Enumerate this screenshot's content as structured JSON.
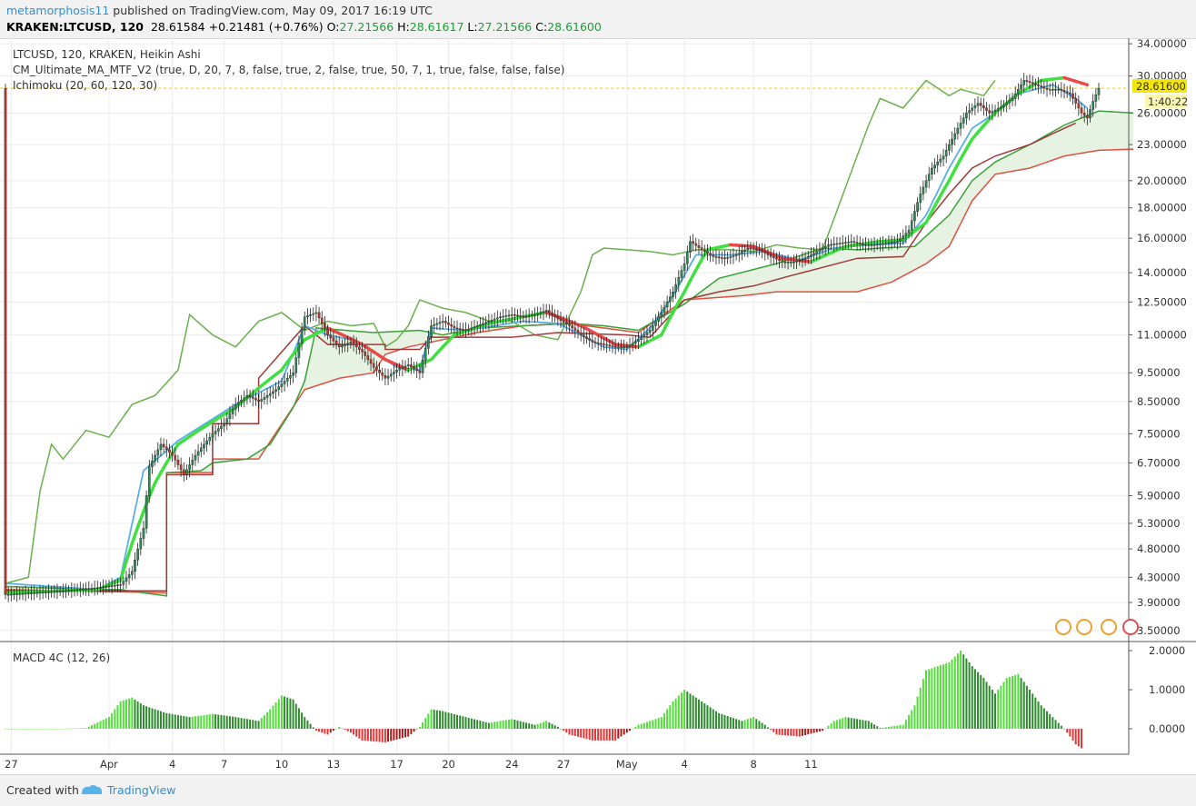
{
  "header": {
    "author": "metamorphosis11",
    "published_text": "published on TradingView.com, May 09, 2017 16:19 UTC",
    "symbol_line": "KRAKEN:LTCUSD, 120",
    "last": "28.61584",
    "change": "+0.21481 (+0.76%)",
    "open_label": "O:",
    "open": "27.21566",
    "high_label": "H:",
    "high": "28.61617",
    "low_label": "L:",
    "low": "27.21566",
    "close_label": "C:",
    "close": "28.61600"
  },
  "legend": {
    "main": "LTCUSD, 120, KRAKEN, Heikin Ashi",
    "indicator1": "CM_Ultimate_MA_MTF_V2 (true, D, 20, 7, 8, false, true, 2, false, true, 50, 7, 1, true, false, false, false)",
    "indicator2": "Ichimoku (20, 60, 120, 30)",
    "macd": "MACD 4C (12, 26)"
  },
  "price_tag": {
    "value": "28.61600",
    "countdown": "1:40:22"
  },
  "footer": {
    "created": "Created with",
    "brand": "TradingView"
  },
  "colors": {
    "up": "#2e8b57",
    "down": "#c0392b",
    "ma_up": "#40e040",
    "ma_down": "#e84a4a",
    "conversion": "#5aaee8",
    "base": "#9e3a3a",
    "lagging": "#6ab04c",
    "span_a": "#3aa03a",
    "span_b": "#e05040",
    "cloud": "#e6f2e2",
    "macd_up": "#55dd3c",
    "macd_up2": "#2e8b2e",
    "macd_down": "#e03a3a",
    "macd_down2": "#a31e1e"
  },
  "chart_data": {
    "type": "candlestick",
    "price_axis_ticks": [
      "34.00000",
      "30.00000",
      "26.00000",
      "23.00000",
      "20.00000",
      "18.00000",
      "16.00000",
      "14.00000",
      "12.50000",
      "11.00000",
      "9.50000",
      "8.50000",
      "7.50000",
      "6.70000",
      "5.90000",
      "5.30000",
      "4.80000",
      "4.30000",
      "3.90000",
      "3.50000"
    ],
    "date_ticks": [
      "27",
      "Apr",
      "4",
      "7",
      "10",
      "13",
      "17",
      "20",
      "24",
      "27",
      "May",
      "4",
      "8",
      "11"
    ],
    "macd_axis_ticks": [
      "2.0000",
      "1.0000",
      "0.0000"
    ],
    "ylim": [
      3.4,
      34.5
    ],
    "scale": "log",
    "price_path": [
      [
        0,
        4.02
      ],
      [
        5,
        4.05
      ],
      [
        10,
        4.08
      ],
      [
        15,
        4.12
      ],
      [
        20,
        4.18
      ],
      [
        22,
        4.4
      ],
      [
        24,
        5.2
      ],
      [
        25,
        6.6
      ],
      [
        27,
        7.2
      ],
      [
        29,
        6.9
      ],
      [
        31,
        6.4
      ],
      [
        33,
        6.9
      ],
      [
        36,
        7.5
      ],
      [
        38,
        7.8
      ],
      [
        40,
        8.4
      ],
      [
        42,
        8.7
      ],
      [
        44,
        8.5
      ],
      [
        47,
        8.9
      ],
      [
        50,
        9.5
      ],
      [
        52,
        11.8
      ],
      [
        54,
        12.0
      ],
      [
        56,
        11.0
      ],
      [
        58,
        10.5
      ],
      [
        60,
        10.7
      ],
      [
        62,
        10.3
      ],
      [
        64,
        9.7
      ],
      [
        66,
        9.3
      ],
      [
        68,
        9.6
      ],
      [
        70,
        9.8
      ],
      [
        72,
        9.5
      ],
      [
        74,
        11.4
      ],
      [
        76,
        11.6
      ],
      [
        78,
        11.3
      ],
      [
        80,
        11.2
      ],
      [
        82,
        11.4
      ],
      [
        84,
        11.6
      ],
      [
        86,
        11.8
      ],
      [
        88,
        11.9
      ],
      [
        90,
        11.8
      ],
      [
        92,
        11.9
      ],
      [
        94,
        12.1
      ],
      [
        96,
        11.7
      ],
      [
        98,
        11.4
      ],
      [
        100,
        11.0
      ],
      [
        102,
        10.7
      ],
      [
        104,
        10.6
      ],
      [
        106,
        10.5
      ],
      [
        108,
        10.5
      ],
      [
        110,
        10.8
      ],
      [
        112,
        11.2
      ],
      [
        114,
        12.0
      ],
      [
        116,
        13.0
      ],
      [
        118,
        14.5
      ],
      [
        119,
        15.8
      ],
      [
        121,
        15.3
      ],
      [
        123,
        14.9
      ],
      [
        125,
        14.8
      ],
      [
        127,
        15.0
      ],
      [
        129,
        15.4
      ],
      [
        131,
        15.3
      ],
      [
        133,
        14.9
      ],
      [
        135,
        14.6
      ],
      [
        137,
        14.6
      ],
      [
        139,
        14.8
      ],
      [
        141,
        15.2
      ],
      [
        143,
        15.6
      ],
      [
        145,
        15.7
      ],
      [
        147,
        15.8
      ],
      [
        149,
        15.6
      ],
      [
        151,
        15.6
      ],
      [
        153,
        15.7
      ],
      [
        155,
        15.8
      ],
      [
        157,
        16.5
      ],
      [
        159,
        19.0
      ],
      [
        161,
        21.0
      ],
      [
        163,
        22.0
      ],
      [
        165,
        24.0
      ],
      [
        167,
        26.0
      ],
      [
        169,
        27.0
      ],
      [
        171,
        26.0
      ],
      [
        173,
        26.6
      ],
      [
        175,
        27.5
      ],
      [
        177,
        29.5
      ],
      [
        179,
        29.0
      ],
      [
        181,
        28.5
      ],
      [
        183,
        28.5
      ],
      [
        185,
        28.0
      ],
      [
        187,
        26.0
      ],
      [
        188,
        25.5
      ],
      [
        189,
        27.2
      ],
      [
        190,
        28.6
      ]
    ],
    "ma_path": [
      [
        0,
        4.05
      ],
      [
        16,
        4.1
      ],
      [
        20,
        4.25
      ],
      [
        26,
        6.2
      ],
      [
        30,
        7.2
      ],
      [
        40,
        8.3
      ],
      [
        48,
        9.6
      ],
      [
        52,
        10.8
      ],
      [
        56,
        11.3
      ],
      [
        62,
        10.6
      ],
      [
        66,
        10.0
      ],
      [
        70,
        9.6
      ],
      [
        74,
        10.0
      ],
      [
        78,
        11.0
      ],
      [
        84,
        11.5
      ],
      [
        94,
        12.0
      ],
      [
        100,
        11.4
      ],
      [
        106,
        10.6
      ],
      [
        110,
        10.5
      ],
      [
        114,
        11.0
      ],
      [
        118,
        13.0
      ],
      [
        122,
        15.3
      ],
      [
        126,
        15.6
      ],
      [
        130,
        15.5
      ],
      [
        135,
        14.8
      ],
      [
        140,
        14.6
      ],
      [
        146,
        15.5
      ],
      [
        152,
        15.8
      ],
      [
        156,
        15.9
      ],
      [
        160,
        17.0
      ],
      [
        164,
        20.0
      ],
      [
        168,
        23.5
      ],
      [
        172,
        26.0
      ],
      [
        176,
        28.0
      ],
      [
        180,
        29.5
      ],
      [
        184,
        29.8
      ],
      [
        188,
        29.0
      ]
    ],
    "conversion_path": [
      [
        0,
        4.2
      ],
      [
        16,
        4.1
      ],
      [
        20,
        4.3
      ],
      [
        24,
        6.5
      ],
      [
        30,
        7.3
      ],
      [
        40,
        8.4
      ],
      [
        48,
        9.2
      ],
      [
        52,
        11.4
      ],
      [
        56,
        11.0
      ],
      [
        60,
        10.8
      ],
      [
        64,
        10.3
      ],
      [
        68,
        9.7
      ],
      [
        72,
        9.6
      ],
      [
        74,
        11.3
      ],
      [
        80,
        11.2
      ],
      [
        90,
        11.6
      ],
      [
        96,
        11.5
      ],
      [
        100,
        11.0
      ],
      [
        104,
        10.5
      ],
      [
        108,
        10.4
      ],
      [
        112,
        11.3
      ],
      [
        116,
        12.8
      ],
      [
        120,
        15.0
      ],
      [
        126,
        15.0
      ],
      [
        132,
        15.2
      ],
      [
        138,
        14.7
      ],
      [
        144,
        15.4
      ],
      [
        150,
        15.6
      ],
      [
        156,
        15.7
      ],
      [
        160,
        17.5
      ],
      [
        164,
        21.0
      ],
      [
        168,
        24.5
      ],
      [
        172,
        26.0
      ],
      [
        176,
        28.0
      ],
      [
        182,
        29.0
      ],
      [
        186,
        27.5
      ],
      [
        188,
        26.5
      ]
    ],
    "base_path": [
      [
        0,
        4.08
      ],
      [
        28,
        4.08
      ],
      [
        28,
        6.4
      ],
      [
        36,
        6.4
      ],
      [
        36,
        7.8
      ],
      [
        44,
        7.8
      ],
      [
        44,
        9.3
      ],
      [
        52,
        11.4
      ],
      [
        56,
        10.6
      ],
      [
        66,
        10.6
      ],
      [
        66,
        10.4
      ],
      [
        72,
        10.4
      ],
      [
        74,
        10.9
      ],
      [
        88,
        10.9
      ],
      [
        96,
        11.1
      ],
      [
        108,
        11.0
      ],
      [
        112,
        10.9
      ],
      [
        118,
        12.6
      ],
      [
        124,
        13.0
      ],
      [
        130,
        13.3
      ],
      [
        136,
        13.8
      ],
      [
        148,
        14.8
      ],
      [
        156,
        14.9
      ],
      [
        160,
        17.0
      ],
      [
        164,
        19.0
      ],
      [
        168,
        21.0
      ],
      [
        172,
        22.0
      ],
      [
        178,
        23.0
      ],
      [
        182,
        24.0
      ],
      [
        186,
        25.0
      ]
    ],
    "lagging_path": [
      [
        0,
        4.2
      ],
      [
        4,
        4.3
      ],
      [
        6,
        6.0
      ],
      [
        8,
        7.2
      ],
      [
        10,
        6.8
      ],
      [
        14,
        7.6
      ],
      [
        18,
        7.4
      ],
      [
        22,
        8.4
      ],
      [
        26,
        8.7
      ],
      [
        30,
        9.6
      ],
      [
        32,
        11.9
      ],
      [
        36,
        11.0
      ],
      [
        40,
        10.5
      ],
      [
        44,
        11.6
      ],
      [
        48,
        12.0
      ],
      [
        52,
        11.2
      ],
      [
        56,
        11.6
      ],
      [
        60,
        11.4
      ],
      [
        64,
        11.5
      ],
      [
        66,
        10.5
      ],
      [
        68,
        10.8
      ],
      [
        70,
        11.4
      ],
      [
        72,
        12.6
      ],
      [
        76,
        12.2
      ],
      [
        80,
        12.0
      ],
      [
        84,
        11.6
      ],
      [
        88,
        11.6
      ],
      [
        92,
        11.0
      ],
      [
        96,
        10.8
      ],
      [
        100,
        13.0
      ],
      [
        102,
        15.0
      ],
      [
        104,
        15.4
      ],
      [
        108,
        15.3
      ],
      [
        112,
        15.2
      ],
      [
        116,
        15.0
      ],
      [
        120,
        15.3
      ],
      [
        126,
        15.3
      ],
      [
        130,
        15.2
      ],
      [
        134,
        15.6
      ],
      [
        138,
        15.4
      ],
      [
        142,
        15.3
      ],
      [
        146,
        19.5
      ],
      [
        148,
        22.0
      ],
      [
        150,
        24.8
      ],
      [
        152,
        27.5
      ],
      [
        156,
        26.5
      ],
      [
        160,
        29.5
      ],
      [
        164,
        27.8
      ],
      [
        166,
        28.5
      ],
      [
        170,
        27.8
      ],
      [
        172,
        29.5
      ]
    ],
    "span_a_path": [
      [
        0,
        4.15
      ],
      [
        16,
        4.1
      ],
      [
        20,
        4.1
      ],
      [
        28,
        4.0
      ],
      [
        28,
        6.45
      ],
      [
        34,
        6.5
      ],
      [
        36,
        6.7
      ],
      [
        42,
        6.8
      ],
      [
        46,
        7.2
      ],
      [
        50,
        8.3
      ],
      [
        52,
        9.2
      ],
      [
        54,
        11.3
      ],
      [
        64,
        11.1
      ],
      [
        72,
        11.2
      ],
      [
        76,
        11.0
      ],
      [
        82,
        11.3
      ],
      [
        90,
        11.4
      ],
      [
        98,
        11.5
      ],
      [
        104,
        11.4
      ],
      [
        110,
        11.2
      ],
      [
        118,
        12.4
      ],
      [
        124,
        13.7
      ],
      [
        134,
        14.5
      ],
      [
        142,
        15.4
      ],
      [
        148,
        15.3
      ],
      [
        152,
        15.4
      ],
      [
        158,
        15.5
      ],
      [
        164,
        17.5
      ],
      [
        168,
        20.0
      ],
      [
        172,
        21.5
      ],
      [
        178,
        23.0
      ],
      [
        184,
        24.8
      ],
      [
        190,
        26.2
      ],
      [
        196,
        26.0
      ]
    ],
    "span_b_path": [
      [
        0,
        4.1
      ],
      [
        28,
        4.05
      ],
      [
        28,
        6.45
      ],
      [
        36,
        6.45
      ],
      [
        36,
        6.8
      ],
      [
        44,
        6.8
      ],
      [
        52,
        8.9
      ],
      [
        58,
        9.3
      ],
      [
        64,
        9.5
      ],
      [
        66,
        10.2
      ],
      [
        70,
        10.5
      ],
      [
        76,
        10.8
      ],
      [
        82,
        11.1
      ],
      [
        90,
        11.4
      ],
      [
        98,
        11.5
      ],
      [
        104,
        11.3
      ],
      [
        110,
        11.1
      ],
      [
        118,
        12.6
      ],
      [
        128,
        12.8
      ],
      [
        134,
        13.0
      ],
      [
        142,
        13.0
      ],
      [
        148,
        13.0
      ],
      [
        154,
        13.5
      ],
      [
        160,
        14.5
      ],
      [
        164,
        15.5
      ],
      [
        168,
        18.5
      ],
      [
        172,
        20.5
      ],
      [
        178,
        21.0
      ],
      [
        184,
        22.0
      ],
      [
        190,
        22.5
      ],
      [
        196,
        22.6
      ]
    ],
    "macd_path": [
      [
        0,
        0.0
      ],
      [
        10,
        0.0
      ],
      [
        14,
        0.02
      ],
      [
        18,
        0.3
      ],
      [
        20,
        0.7
      ],
      [
        22,
        0.8
      ],
      [
        24,
        0.6
      ],
      [
        28,
        0.4
      ],
      [
        32,
        0.3
      ],
      [
        36,
        0.38
      ],
      [
        40,
        0.3
      ],
      [
        44,
        0.2
      ],
      [
        46,
        0.5
      ],
      [
        48,
        0.85
      ],
      [
        50,
        0.75
      ],
      [
        52,
        0.3
      ],
      [
        54,
        -0.05
      ],
      [
        56,
        -0.15
      ],
      [
        58,
        0.05
      ],
      [
        60,
        -0.1
      ],
      [
        62,
        -0.3
      ],
      [
        66,
        -0.35
      ],
      [
        70,
        -0.2
      ],
      [
        72,
        0.05
      ],
      [
        74,
        0.5
      ],
      [
        76,
        0.45
      ],
      [
        80,
        0.3
      ],
      [
        84,
        0.15
      ],
      [
        88,
        0.25
      ],
      [
        92,
        0.1
      ],
      [
        94,
        0.2
      ],
      [
        96,
        0.05
      ],
      [
        98,
        -0.15
      ],
      [
        102,
        -0.3
      ],
      [
        106,
        -0.3
      ],
      [
        108,
        -0.1
      ],
      [
        110,
        0.1
      ],
      [
        114,
        0.3
      ],
      [
        116,
        0.7
      ],
      [
        118,
        1.0
      ],
      [
        120,
        0.8
      ],
      [
        124,
        0.4
      ],
      [
        128,
        0.2
      ],
      [
        130,
        0.3
      ],
      [
        132,
        0.1
      ],
      [
        134,
        -0.15
      ],
      [
        138,
        -0.2
      ],
      [
        142,
        -0.05
      ],
      [
        144,
        0.2
      ],
      [
        146,
        0.3
      ],
      [
        150,
        0.2
      ],
      [
        152,
        0.02
      ],
      [
        156,
        0.1
      ],
      [
        158,
        0.6
      ],
      [
        160,
        1.5
      ],
      [
        164,
        1.7
      ],
      [
        166,
        2.0
      ],
      [
        168,
        1.6
      ],
      [
        170,
        1.3
      ],
      [
        172,
        0.9
      ],
      [
        174,
        1.3
      ],
      [
        176,
        1.4
      ],
      [
        178,
        1.0
      ],
      [
        180,
        0.6
      ],
      [
        182,
        0.3
      ],
      [
        184,
        0.0
      ],
      [
        186,
        -0.4
      ],
      [
        187,
        -0.5
      ]
    ]
  }
}
